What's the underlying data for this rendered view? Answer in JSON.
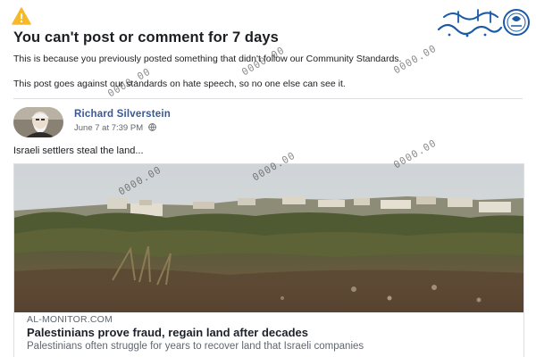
{
  "notice": {
    "title": "You can't post or comment for 7 days",
    "line1": "This is because you previously posted something that didn't follow our Community Standards.",
    "line2": "This post goes against our standards on hate speech, so no one else can see it.",
    "icon": "warning-icon",
    "icon_color": "#f7b928"
  },
  "logo": {
    "icon": "channel-logo",
    "brand_color": "#1c5aa6"
  },
  "post": {
    "author": "Richard Silverstein",
    "timestamp": "June 7 at 7:39 PM",
    "privacy_icon": "globe-icon",
    "text": "Israeli settlers steal the land..."
  },
  "link": {
    "domain": "AL-MONITOR.COM",
    "title": "Palestinians prove fraud, regain land after decades",
    "description": "Palestinians often struggle for years to recover land that Israeli companies"
  },
  "watermark": {
    "text": "0000.00"
  },
  "colors": {
    "author_link": "#385898",
    "secondary_text": "#606770",
    "divider": "#dddfe2"
  }
}
